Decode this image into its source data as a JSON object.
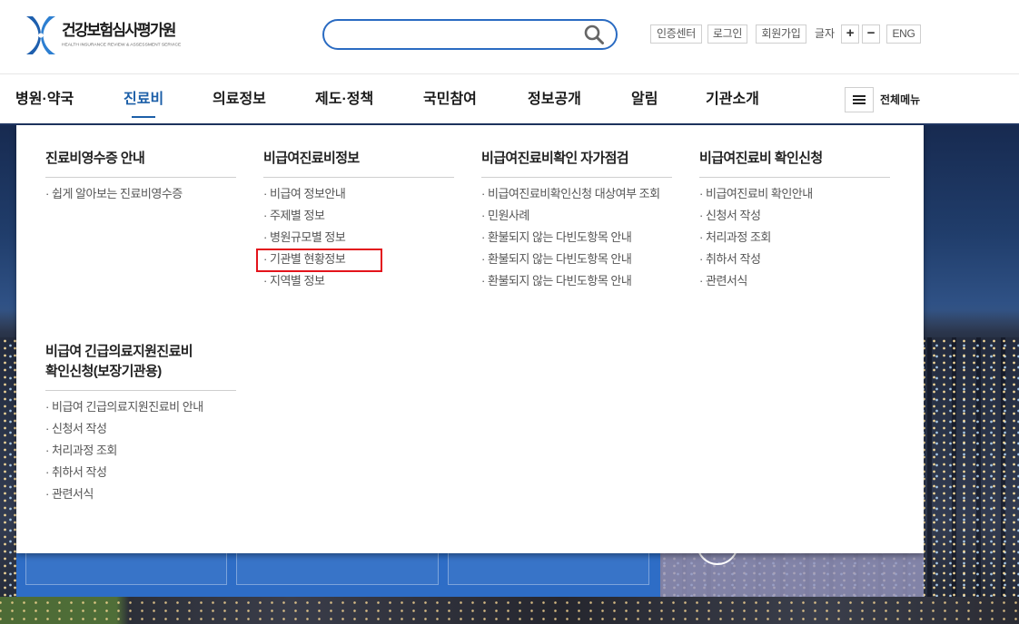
{
  "header": {
    "logo": {
      "name": "건강보험심사평가원",
      "subtitle": "HEALTH INSURANCE REVIEW & ASSESSMENT SERVICE",
      "icon": "hira-logo-icon"
    },
    "search": {
      "value": "",
      "icon": "search-icon"
    },
    "utility": {
      "cert_center": "인증센터",
      "login": "로그인",
      "signup": "회원가입",
      "font_size_label": "글자",
      "font_increase": "+",
      "font_decrease": "−",
      "language": "ENG"
    }
  },
  "nav": {
    "items": [
      "병원·약국",
      "진료비",
      "의료정보",
      "제도·정책",
      "국민참여",
      "정보공개",
      "알림",
      "기관소개"
    ],
    "active_index": 1,
    "all_menu": {
      "label": "전체메뉴",
      "icon": "hamburger-menu-icon"
    }
  },
  "dropdown": {
    "groups": [
      {
        "title": "진료비영수증 안내",
        "items": [
          "쉽게 알아보는 진료비영수증"
        ]
      },
      {
        "title": "비급여진료비정보",
        "items": [
          "비급여 정보안내",
          "주제별 정보",
          "병원규모별 정보",
          "기관별 현황정보",
          "지역별 정보"
        ],
        "highlighted_index": 3
      },
      {
        "title": "비급여진료비확인 자가점검",
        "items": [
          "비급여진료비확인신청 대상여부 조회",
          "민원사례",
          "환불되지 않는 다빈도항목 안내",
          "환불되지 않는 다빈도항목 안내",
          "환불되지 않는 다빈도항목 안내"
        ]
      },
      {
        "title": "비급여진료비 확인신청",
        "items": [
          "비급여진료비 확인안내",
          "신청서 작성",
          "처리과정 조회",
          "취하서 작성",
          "관련서식"
        ]
      },
      {
        "title": "비급여 긴급의료지원진료비 확인신청(보장기관용)",
        "items": [
          "비급여 긴급의료지원진료비 안내",
          "신청서 작성",
          "처리과정 조회",
          "취하서 작성",
          "관련서식"
        ]
      }
    ]
  },
  "colors": {
    "brand_blue": "#1e5fae",
    "nav_active": "#1c5fa8",
    "search_border": "#2a6bc2",
    "highlight_border": "#e3131b"
  }
}
